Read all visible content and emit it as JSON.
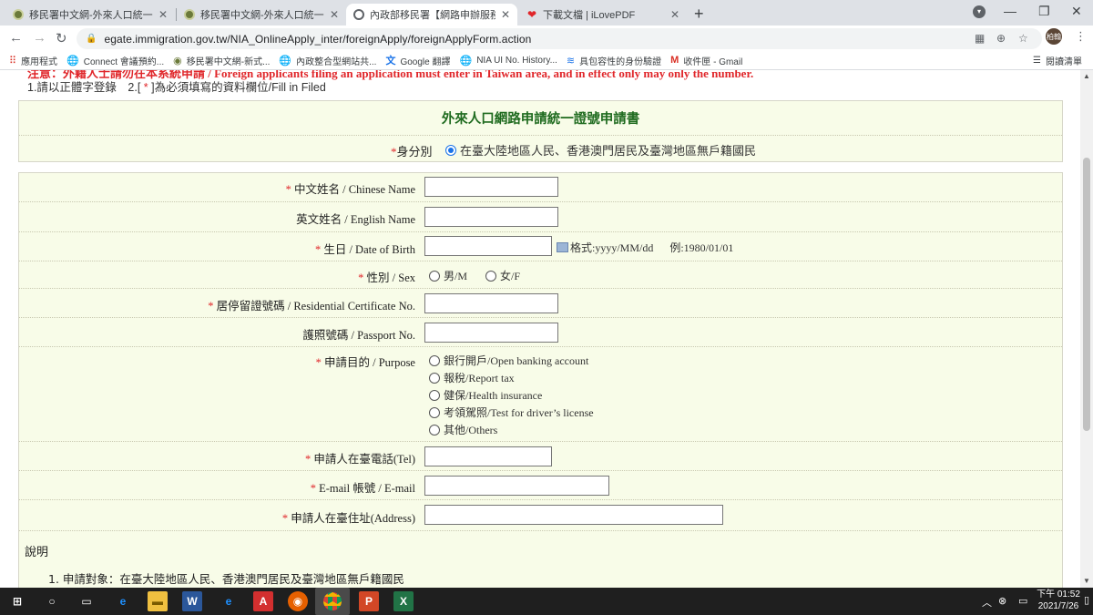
{
  "browser": {
    "tabs": [
      {
        "title": "移民署中文網-外來人口統一證號",
        "active": false
      },
      {
        "title": "移民署中文網-外來人口統一證號申請",
        "active": false
      },
      {
        "title": "內政部移民署【網路申辦服務】",
        "active": true
      },
      {
        "title": "下載文檔 | iLovePDF",
        "active": false
      }
    ],
    "url": "egate.immigration.gov.tw/NIA_OnlineApply_inter/foreignApply/foreignApplyForm.action",
    "profile_initials": "柏翰",
    "bookmarks": [
      {
        "label": "應用程式",
        "icon": "apps-grid-icon"
      },
      {
        "label": "Connect 會議預約...",
        "icon": "globe-icon"
      },
      {
        "label": "移民署中文網-新式...",
        "icon": "nia-logo-icon"
      },
      {
        "label": "內政整合型網站共...",
        "icon": "globe-icon"
      },
      {
        "label": "Google 翻譯",
        "icon": "google-translate-icon"
      },
      {
        "label": "NIA UI No. History...",
        "icon": "globe-icon"
      },
      {
        "label": "具包容性的身份驗證",
        "icon": "wave-icon"
      },
      {
        "label": "收件匣 - Gmail",
        "icon": "gmail-icon"
      }
    ],
    "reading_list": "閱讀清單"
  },
  "page": {
    "cut_text": "注意：外籍人士請勿在本系統申請 / Foreign applicants filing an application must enter in Taiwan area, and in effect only may only the number.",
    "notes": {
      "prefix": "1.請以正體字登錄　2.[",
      "star": " * ",
      "suffix": "]為必須填寫的資料欄位/Fill in Filed"
    },
    "form_title": "外來人口網路申請統一證號申請書",
    "identity": {
      "label": "身分別",
      "option": "在臺大陸地區人民、香港澳門居民及臺灣地區無戶籍國民"
    },
    "fields": {
      "chinese_name": "中文姓名 / Chinese Name",
      "english_name": "英文姓名 / English Name",
      "dob": "生日 / Date of Birth",
      "dob_format": "格式:yyyy/MM/dd",
      "dob_example": "例:1980/01/01",
      "sex": "性別 / Sex",
      "sex_male": "男/M",
      "sex_female": "女/F",
      "residence": "居停留證號碼 / Residential Certificate No.",
      "passport": "護照號碼 / Passport No.",
      "purpose": "申請目的 / Purpose",
      "purpose_options": [
        "銀行開戶/Open banking account",
        "報稅/Report tax",
        "健保/Health insurance",
        "考領駕照/Test for driver’s license",
        "其他/Others"
      ],
      "tel": "申請人在臺電話(Tel)",
      "email": "E-mail 帳號 / E-mail",
      "address": "申請人在臺住址(Address)"
    },
    "description": {
      "title": "說明",
      "item1": "1. 申請對象：在臺大陸地區人民、香港澳門居民及臺灣地區無戶籍國民"
    }
  },
  "taskbar": {
    "time_period": "下午 01:52",
    "date": "2021/7/26"
  }
}
